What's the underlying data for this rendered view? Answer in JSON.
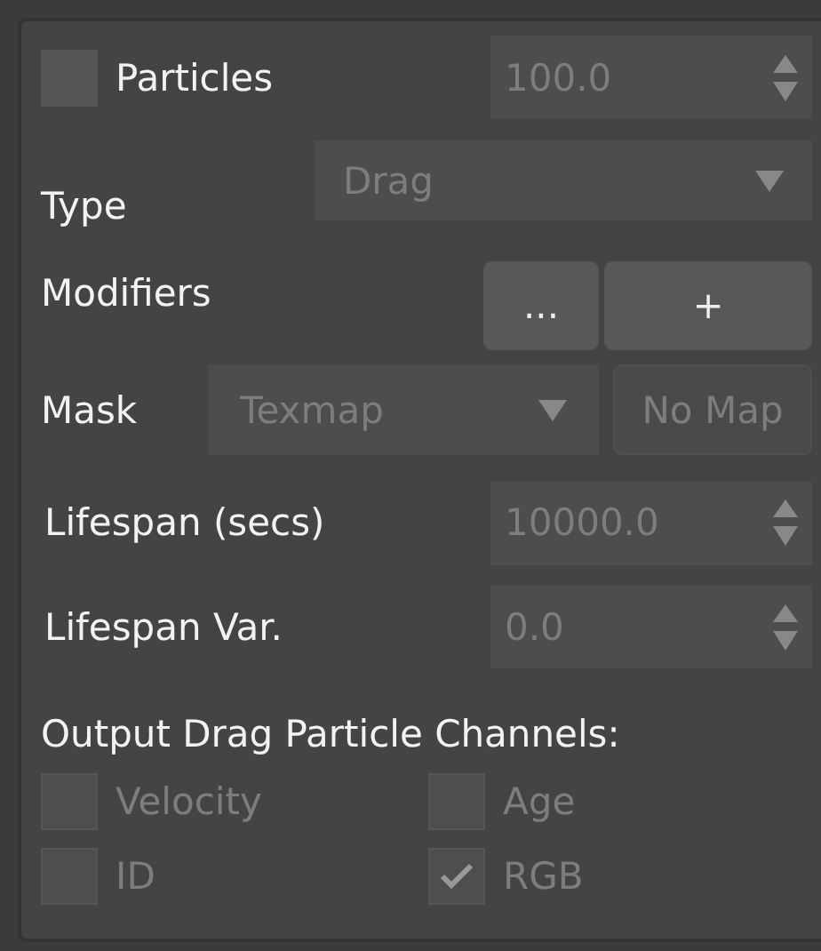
{
  "particles": {
    "label": "Particles",
    "checked": false,
    "value": "100.0",
    "disabled": true
  },
  "type": {
    "label": "Type",
    "value": "Drag",
    "disabled": true
  },
  "modifiers": {
    "label": "Modifiers",
    "buttons": [
      "...",
      "+"
    ]
  },
  "mask": {
    "label": "Mask",
    "value": "Texmap",
    "map_button": "No Map",
    "disabled": true
  },
  "spinners": [
    {
      "label": "Lifespan (secs)",
      "value": "10000.0",
      "disabled": true
    },
    {
      "label": "Lifespan Var.",
      "value": "0.0",
      "disabled": true
    }
  ],
  "channels_title": "Output Drag Particle Channels:",
  "channels": [
    {
      "label": "Velocity",
      "checked": false,
      "disabled": true
    },
    {
      "label": "Age",
      "checked": false,
      "disabled": true
    },
    {
      "label": "ID",
      "checked": false,
      "disabled": true
    },
    {
      "label": "RGB",
      "checked": true,
      "disabled": true
    }
  ]
}
